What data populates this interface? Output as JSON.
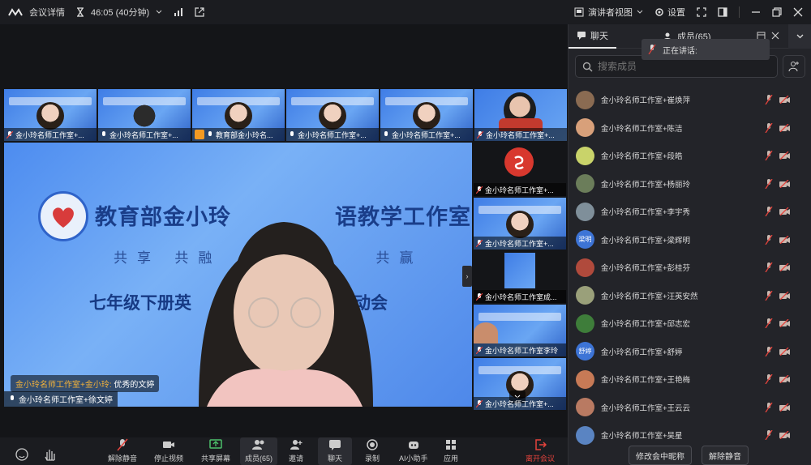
{
  "topbar": {
    "meeting_details": "会议详情",
    "timer": "46:05 (40分钟)",
    "speaker_view": "演讲者视图",
    "settings": "设置"
  },
  "strip": [
    {
      "name": "金小玲名师工作室+..."
    },
    {
      "name": "金小玲名师工作室+..."
    },
    {
      "name": "教育部金小玲名..."
    },
    {
      "name": "金小玲名师工作室+..."
    },
    {
      "name": "金小玲名师工作室+..."
    },
    {
      "name": "金小玲名师工作室+..."
    }
  ],
  "side": [
    {
      "name": "金小玲名师工作室+..."
    },
    {
      "name": "金小玲名师工作室+..."
    },
    {
      "name": "金小玲名师工作室成..."
    },
    {
      "name": "金小玲名师工作室李玲"
    },
    {
      "name": "金小玲名师工作室+..."
    }
  ],
  "main": {
    "slide_title": "教育部金小玲",
    "slide_title_tail": "语教学工作室",
    "slide_motto": "共享  共融",
    "slide_motto_tail": "共赢",
    "slide_subtitle": "七年级下册英",
    "slide_subtitle_tail": "动会",
    "caption_speaker": "金小玲名师工作室+金小玲:",
    "caption_text": "优秀的文婷",
    "name_tag": "金小玲名师工作室+徐文婷"
  },
  "toolbar": {
    "unmute": "解除静音",
    "stop_video": "停止视频",
    "share": "共享屏幕",
    "members": "成员(65)",
    "invite": "邀请",
    "chat": "聊天",
    "record": "录制",
    "ai": "AI小助手",
    "apps": "应用",
    "leave": "离开会议"
  },
  "panel": {
    "tab_chat": "聊天",
    "tab_members": "成员(65)",
    "speaking": "正在讲话:",
    "search_placeholder": "搜索成员",
    "members": [
      {
        "name": "金小玲名师工作室+崔焕萍",
        "avatar": "",
        "color": "#8a6b52"
      },
      {
        "name": "金小玲名师工作室+陈洁",
        "avatar": "",
        "color": "#d8a07a"
      },
      {
        "name": "金小玲名师工作室+段皓",
        "avatar": "",
        "color": "#c9d36a"
      },
      {
        "name": "金小玲名师工作室+杨丽玲",
        "avatar": "",
        "color": "#6b7d5a"
      },
      {
        "name": "金小玲名师工作室+李宇秀",
        "avatar": "",
        "color": "#7f8f9a"
      },
      {
        "name": "金小玲名师工作室+梁辉明",
        "avatar": "梁明",
        "color": "#3d74d6"
      },
      {
        "name": "金小玲名师工作室+彭桂芬",
        "avatar": "",
        "color": "#b04a3c"
      },
      {
        "name": "金小玲名师工作室+汪英安然",
        "avatar": "",
        "color": "#9aa07a"
      },
      {
        "name": "金小玲名师工作室+邱志宏",
        "avatar": "",
        "color": "#3e7d3a"
      },
      {
        "name": "金小玲名师工作室+舒婷",
        "avatar": "舒婷",
        "color": "#3d74d6"
      },
      {
        "name": "金小玲名师工作室+王艳梅",
        "avatar": "",
        "color": "#c77a56"
      },
      {
        "name": "金小玲名师工作室+王云云",
        "avatar": "",
        "color": "#b97a62"
      },
      {
        "name": "金小玲名师工作室+吴星",
        "avatar": "",
        "color": "#5a84c2"
      }
    ],
    "btn_rename": "修改会中昵称",
    "btn_unmute_all": "解除静音"
  }
}
